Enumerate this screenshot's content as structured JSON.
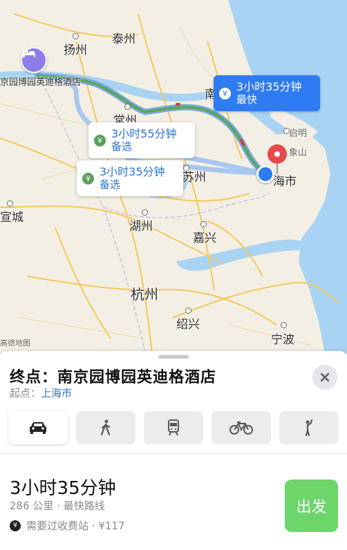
{
  "map": {
    "watermark": "高德地图",
    "cities": {
      "yangzhou": "扬州",
      "taizhou": "泰州",
      "changzhou": "常州",
      "suzhou": "苏州",
      "huzhou": "湖州",
      "jiaxing": "嘉兴",
      "hangzhou": "杭州",
      "shaoxing": "绍兴",
      "ningbo": "宁波",
      "xuancheng": "宣城",
      "nantong_partial": "南",
      "shanghai_partial": "海市",
      "qiming": "启明",
      "xiangshan": "象山"
    },
    "hotel_label": "京园博园英迪格酒店",
    "routes": [
      {
        "duration": "3小时35分钟",
        "tag": "最快",
        "selected": true
      },
      {
        "duration": "3小时55分钟",
        "tag": "备选",
        "selected": false
      },
      {
        "duration": "3小时35分钟",
        "tag": "备选",
        "selected": false
      }
    ],
    "colors": {
      "water": "#a9d3f2",
      "land": "#f4efe4",
      "route_main": "#5aa75a",
      "route_alt": "#a8c6ef",
      "accent": "#2f7bf2"
    }
  },
  "sheet": {
    "destination": "终点：南京园博园英迪格酒店",
    "origin_label": "起点：",
    "origin_value": "上海市",
    "modes": [
      {
        "name": "car",
        "icon": "car-icon",
        "selected": true
      },
      {
        "name": "walk",
        "icon": "walk-icon",
        "selected": false
      },
      {
        "name": "transit",
        "icon": "train-icon",
        "selected": false
      },
      {
        "name": "bike",
        "icon": "bike-icon",
        "selected": false
      },
      {
        "name": "ride",
        "icon": "hail-icon",
        "selected": false
      }
    ],
    "route_duration": "3小时35分钟",
    "route_meta": "286 公里 · 最快路线",
    "toll_text": "需要过收费站 · ¥117",
    "go_label": "出发"
  }
}
